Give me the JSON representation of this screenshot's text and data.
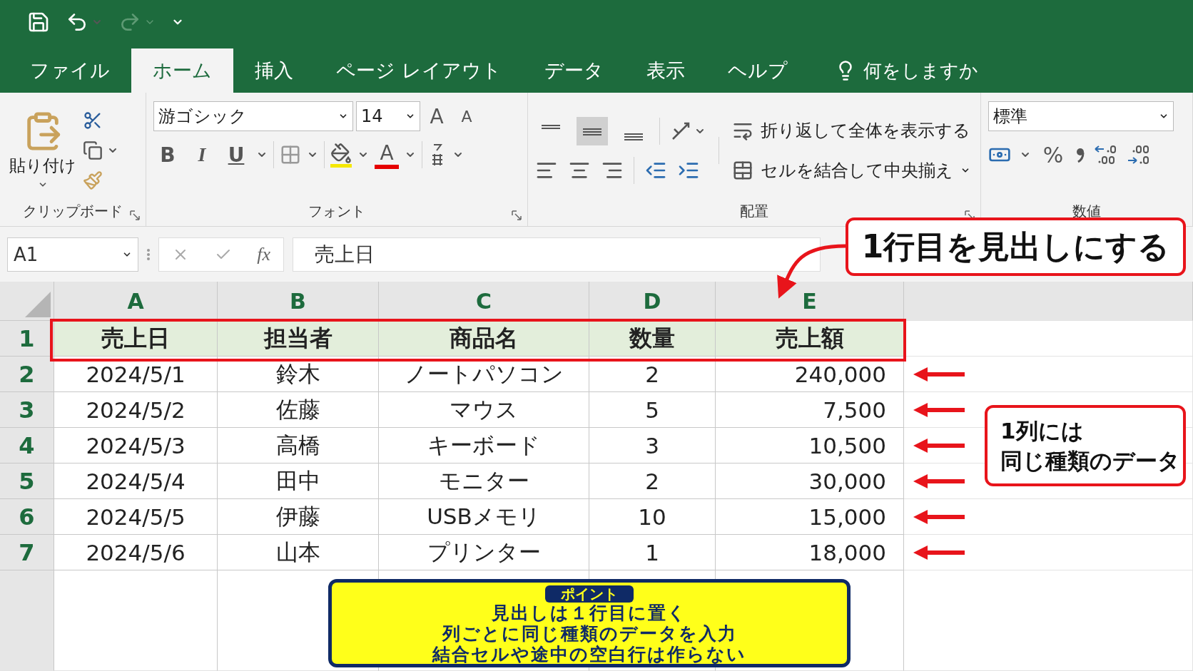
{
  "tabs": [
    {
      "label": "ファイル",
      "selected": false
    },
    {
      "label": "ホーム",
      "selected": true
    },
    {
      "label": "挿入",
      "selected": false
    },
    {
      "label": "ページ レイアウト",
      "selected": false
    },
    {
      "label": "データ",
      "selected": false
    },
    {
      "label": "表示",
      "selected": false
    },
    {
      "label": "ヘルプ",
      "selected": false
    }
  ],
  "tell_me": "何をしますか",
  "ribbon": {
    "clipboard": {
      "paste": "貼り付け",
      "group": "クリップボード"
    },
    "font": {
      "name": "游ゴシック",
      "size": "14",
      "grow": "A",
      "shrink": "A",
      "bold": "B",
      "italic": "I",
      "underline": "U",
      "font_color": "A",
      "group": "フォント"
    },
    "alignment": {
      "wrap": "折り返して全体を表示する",
      "merge": "セルを結合して中央揃え",
      "group": "配置"
    },
    "number": {
      "format": "標準",
      "percent": "%",
      "group": "数値"
    }
  },
  "formula_bar": {
    "name_box": "A1",
    "fx": "fx",
    "value": "売上日"
  },
  "sheet": {
    "columns": [
      "A",
      "B",
      "C",
      "D",
      "E"
    ],
    "rows": [
      {
        "number": "1",
        "header": true,
        "marked": false,
        "cells": [
          "売上日",
          "担当者",
          "商品名",
          "数量",
          "売上額"
        ]
      },
      {
        "number": "2",
        "header": false,
        "marked": true,
        "cells": [
          "2024/5/1",
          "鈴木",
          "ノートパソコン",
          "2",
          "240,000"
        ]
      },
      {
        "number": "3",
        "header": false,
        "marked": true,
        "cells": [
          "2024/5/2",
          "佐藤",
          "マウス",
          "5",
          "7,500"
        ]
      },
      {
        "number": "4",
        "header": false,
        "marked": true,
        "cells": [
          "2024/5/3",
          "高橋",
          "キーボード",
          "3",
          "10,500"
        ]
      },
      {
        "number": "5",
        "header": false,
        "marked": true,
        "cells": [
          "2024/5/4",
          "田中",
          "モニター",
          "2",
          "30,000"
        ]
      },
      {
        "number": "6",
        "header": false,
        "marked": true,
        "cells": [
          "2024/5/5",
          "伊藤",
          "USBメモリ",
          "10",
          "15,000"
        ]
      },
      {
        "number": "7",
        "header": false,
        "marked": true,
        "cells": [
          "2024/5/6",
          "山本",
          "プリンター",
          "1",
          "18,000"
        ]
      }
    ]
  },
  "annotations": {
    "heading_callout": "1行目を見出しにする",
    "column_callout": [
      "1列には",
      "同じ種類のデータ"
    ],
    "point": {
      "badge": "ポイント",
      "lines": [
        "見出しは１行目に置く",
        "列ごとに同じ種類のデータを入力",
        "結合セルや途中の空白行は作らない"
      ]
    }
  }
}
